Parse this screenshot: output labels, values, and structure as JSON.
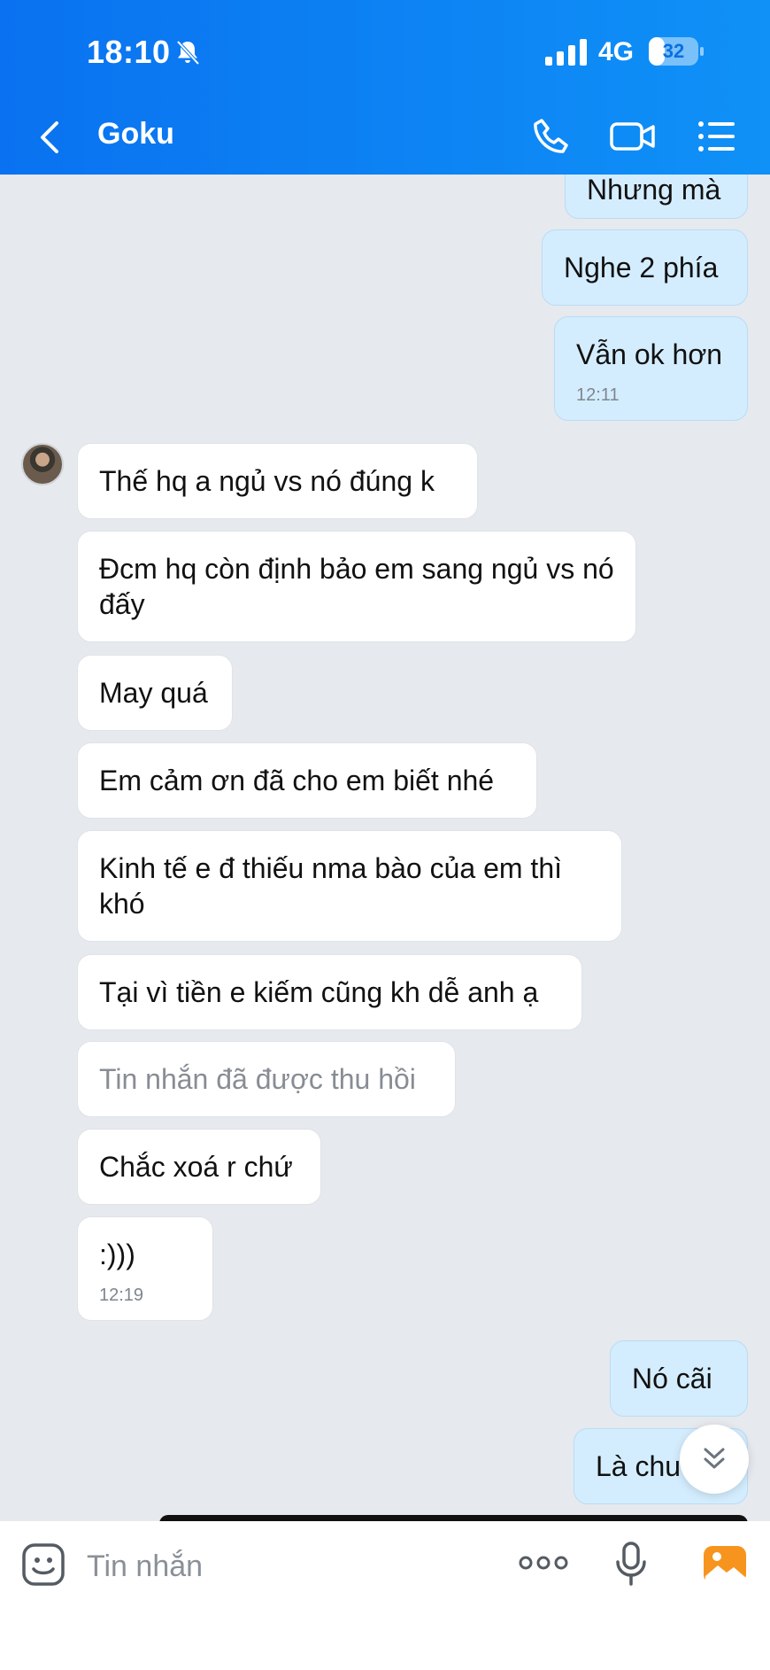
{
  "status_bar": {
    "time": "18:10",
    "network": "4G",
    "battery": "32",
    "battery_fraction": 0.32
  },
  "header": {
    "contact_name": "Goku"
  },
  "icons": [
    "bell-off-icon",
    "signal-icon",
    "battery-icon",
    "back-icon",
    "phone-icon",
    "video-call-icon",
    "menu-list-icon",
    "chevrons-down-icon",
    "emoji-icon",
    "more-icon",
    "microphone-icon",
    "gallery-icon"
  ],
  "messages": [
    {
      "text": "Nhưng mà",
      "time": ""
    },
    {
      "text": "Nghe 2 phía",
      "time": ""
    },
    {
      "text": "Vẫn ok hơn",
      "time": "12:11"
    },
    {
      "text": "Thế hq a ngủ vs nó đúng k",
      "time": ""
    },
    {
      "text": "Đcm hq còn định bảo em sang ngủ vs nó đấy",
      "time": ""
    },
    {
      "text": "May quá",
      "time": ""
    },
    {
      "text": "Em cảm ơn đã cho em biết nhé",
      "time": ""
    },
    {
      "text": "Kinh tế e đ thiếu nma bào của em thì khó",
      "time": ""
    },
    {
      "text": "Tại vì tiền e kiếm cũng kh dễ anh ạ",
      "time": ""
    },
    {
      "text": "Tin nhắn đã được thu hồi",
      "time": ""
    },
    {
      "text": "Chắc xoá r chứ",
      "time": ""
    },
    {
      "text": ":)))",
      "time": "12:19"
    },
    {
      "text": "Nó cãi",
      "time": ""
    },
    {
      "text": "Là chu",
      "time": ""
    }
  ],
  "input": {
    "placeholder": "Tin nhắn",
    "value": ""
  },
  "colors": {
    "header": "#0d85f4",
    "outgoing_bubble": "#d4edfe",
    "incoming_bubble": "#ffffff",
    "background": "#e6e9ee",
    "gallery_icon": "#f7941d"
  }
}
